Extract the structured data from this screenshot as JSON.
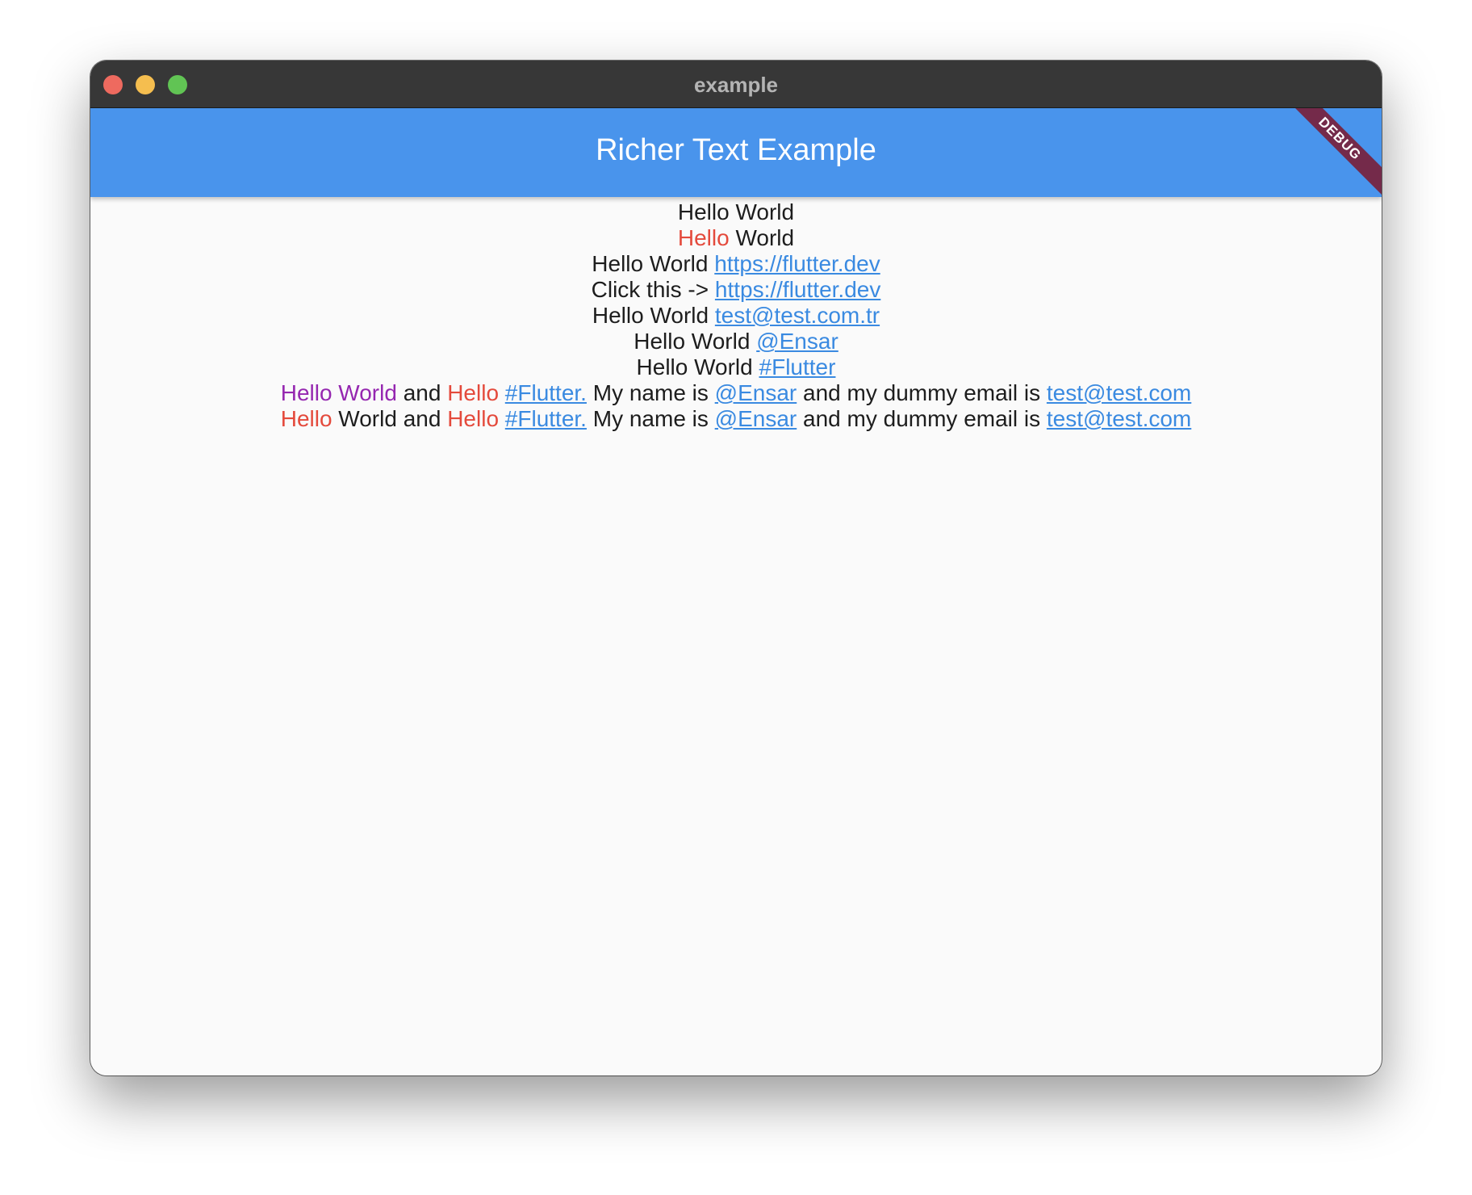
{
  "window": {
    "title": "example"
  },
  "appbar": {
    "title": "Richer Text Example",
    "debug_banner": "DEBUG"
  },
  "lines": [
    {
      "parts": [
        {
          "text": "Hello World"
        }
      ]
    },
    {
      "parts": [
        {
          "text": "Hello"
        },
        {
          "text": " World"
        }
      ]
    },
    {
      "parts": [
        {
          "text": "Hello World "
        },
        {
          "text": "https://flutter.dev"
        }
      ]
    },
    {
      "parts": [
        {
          "text": "Click this -> "
        },
        {
          "text": "https://flutter.dev"
        }
      ]
    },
    {
      "parts": [
        {
          "text": "Hello World "
        },
        {
          "text": "test@test.com.tr"
        }
      ]
    },
    {
      "parts": [
        {
          "text": "Hello World "
        },
        {
          "text": "@Ensar"
        }
      ]
    },
    {
      "parts": [
        {
          "text": "Hello World "
        },
        {
          "text": "#Flutter"
        }
      ]
    },
    {
      "parts": [
        {
          "text": "Hello World"
        },
        {
          "text": " and "
        },
        {
          "text": "Hello"
        },
        {
          "text": " "
        },
        {
          "text": "#Flutter."
        },
        {
          "text": " My name is "
        },
        {
          "text": "@Ensar"
        },
        {
          "text": " and my dummy email is "
        },
        {
          "text": "test@test.com"
        }
      ]
    },
    {
      "parts": [
        {
          "text": "Hello"
        },
        {
          "text": " World and "
        },
        {
          "text": "Hello"
        },
        {
          "text": " "
        },
        {
          "text": "#Flutter."
        },
        {
          "text": " My name is "
        },
        {
          "text": "@Ensar"
        },
        {
          "text": " and my dummy email is "
        },
        {
          "text": "test@test.com"
        }
      ]
    }
  ],
  "colors": {
    "titlebar": "#373737",
    "appbar": "#4994ec",
    "link": "#3a8ae1",
    "red": "#e44a3c",
    "purple": "#9527b0",
    "text": "#1d1d1d",
    "background": "#fafafa",
    "debug_banner": "#742a4a"
  }
}
